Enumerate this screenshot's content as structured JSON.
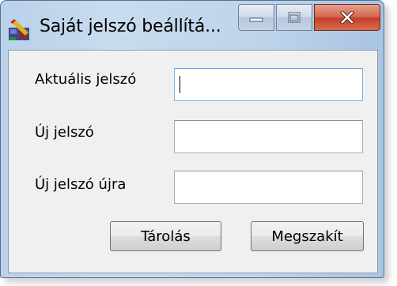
{
  "window": {
    "title": "Saját jelszó beállítá...",
    "caption_buttons": {
      "minimize_icon": "minimize-icon",
      "maximize_icon": "maximize-icon",
      "close_icon": "close-icon"
    }
  },
  "form": {
    "current_password_label": "Aktuális jelszó",
    "current_password_value": "",
    "new_password_label": "Új jelszó",
    "new_password_value": "",
    "new_password_again_label": "Új jelszó újra",
    "new_password_again_value": ""
  },
  "buttons": {
    "save_label": "Tárolás",
    "cancel_label": "Megszakít"
  },
  "colors": {
    "window_frame": "#b9d1ea",
    "client_background": "#f0f0f0",
    "close_button": "#c4402a",
    "focused_field_border": "#7eb4ea"
  }
}
